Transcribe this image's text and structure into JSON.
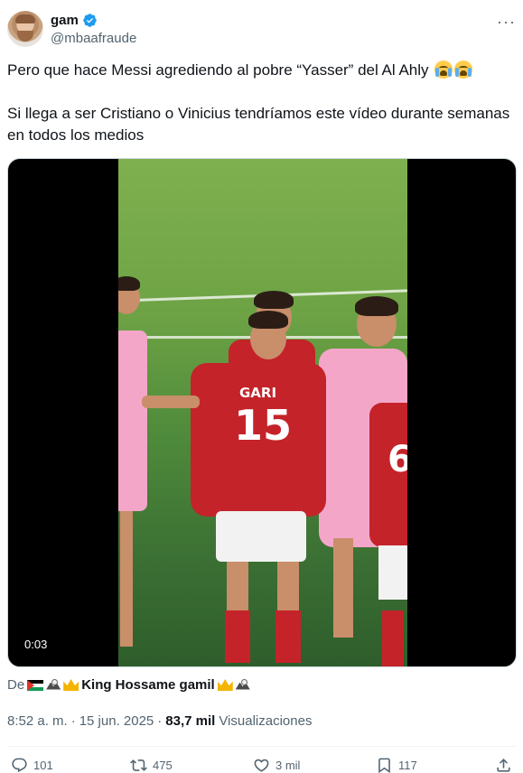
{
  "author": {
    "display_name": "gam",
    "handle": "@mbaafraude",
    "verified": true
  },
  "tweet": {
    "paragraph1": "Pero que hace Messi agrediendo al pobre “Yasser” del Al Ahly",
    "paragraph1_emojis": [
      "loudly-crying-face",
      "loudly-crying-face"
    ],
    "paragraph2": "Si llega a ser Cristiano o Vinicius tendríamos este vídeo durante semanas en todos los medios"
  },
  "media": {
    "duration": "0:03",
    "jersey_name": "GARI",
    "jersey_number": "15",
    "jersey_number_2": "6"
  },
  "attribution": {
    "prefix": "De",
    "source_name": "King Hossame gamil"
  },
  "meta": {
    "time": "8:52 a. m.",
    "separator": "·",
    "date": "15 jun. 2025",
    "views_count": "83,7 mil",
    "views_label": "Visualizaciones"
  },
  "actions": {
    "replies": "101",
    "reposts": "475",
    "likes": "3 mil",
    "bookmarks": "117"
  },
  "colors": {
    "text": "#0f1419",
    "secondary": "#536471",
    "verified": "#1d9bf0"
  }
}
